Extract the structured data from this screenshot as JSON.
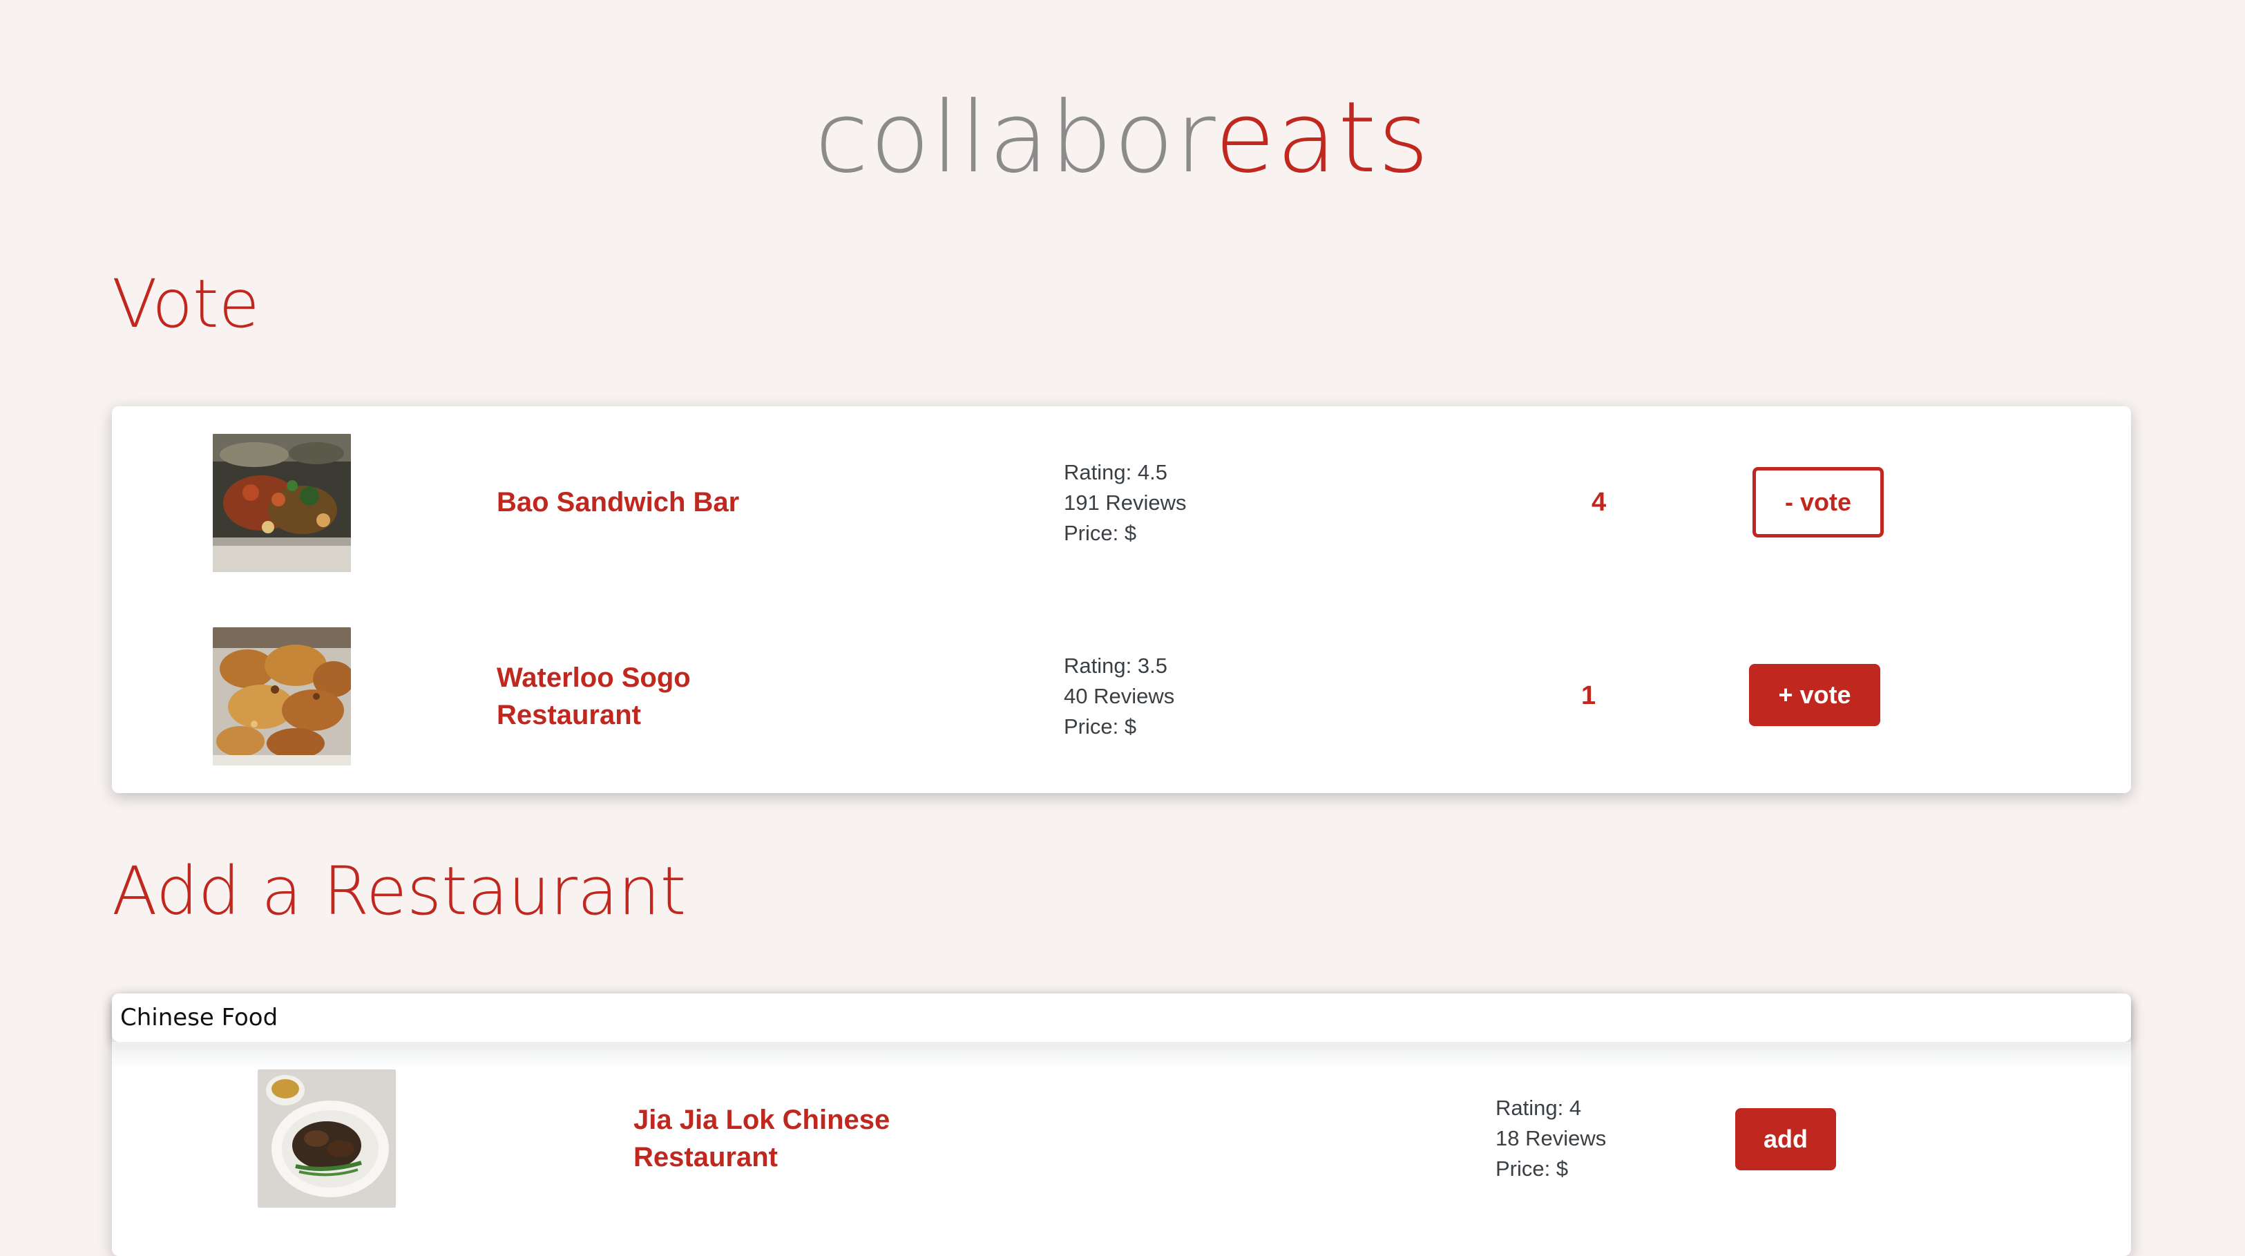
{
  "logo": {
    "part1": "collabor",
    "part2": "eats"
  },
  "vote_section": {
    "title": "Vote",
    "items": [
      {
        "name": "Bao Sandwich Bar",
        "rating": "Rating: 4.5",
        "reviews": "191 Reviews",
        "price": "Price: $",
        "votes": "4",
        "button": "- vote"
      },
      {
        "name_line1": "Waterloo Sogo",
        "name_line2": "Restaurant",
        "rating": "Rating: 3.5",
        "reviews": "40 Reviews",
        "price": "Price: $",
        "votes": "1",
        "button": "+ vote"
      }
    ]
  },
  "add_section": {
    "title": "Add a Restaurant",
    "search_value": "Chinese Food",
    "results": [
      {
        "name_line1": "Jia Jia Lok Chinese",
        "name_line2": "Restaurant",
        "rating": "Rating: 4",
        "reviews": "18 Reviews",
        "price": "Price: $",
        "button": "add"
      }
    ]
  },
  "colors": {
    "accent": "#c0281f",
    "logo_gray": "#8c8b8b",
    "background": "#f8f3f1"
  },
  "icons": {
    "thumb1": "food-photo-bao-icon",
    "thumb2": "food-photo-chicken-icon",
    "thumb3": "food-photo-plate-icon"
  }
}
